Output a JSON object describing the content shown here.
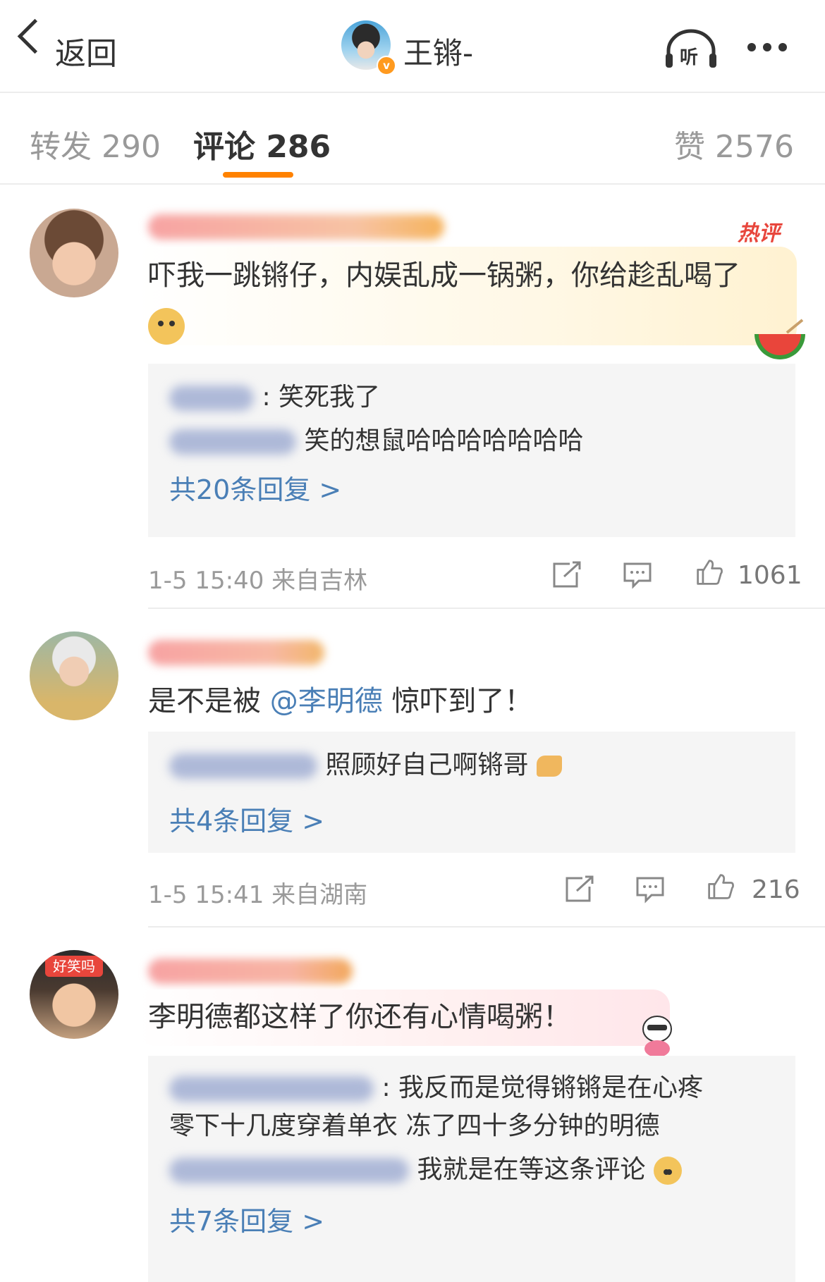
{
  "header": {
    "back_label": "返回",
    "owner_name": "王锵-",
    "listen_label": "听",
    "verified_badge": "v"
  },
  "tabs": {
    "repost": "转发 290",
    "comment": "评论 286",
    "like": "赞 2576"
  },
  "colors": {
    "accent": "#ff8200",
    "link": "#4a7fb6",
    "meta": "#9a9a9a",
    "reply_bg": "#f5f5f5"
  },
  "comments": [
    {
      "badge": "热评",
      "text": "吓我一跳锵仔，内娱乱成一锅粥，你给趁乱喝了",
      "replies": [
        {
          "text": "笑死我了",
          "prefix": ":"
        },
        {
          "text": "笑的想鼠哈哈哈哈哈哈哈",
          "prefix": ""
        }
      ],
      "more": "共20条回复 >",
      "time": "1-5 15:40",
      "location": "来自吉林",
      "likes": "1061"
    },
    {
      "text_before": "是不是被",
      "mention": "@李明德",
      "text_after": "惊吓到了！",
      "replies": [
        {
          "text": "照顾好自己啊锵哥",
          "prefix": ""
        }
      ],
      "more": "共4条回复 >",
      "time": "1-5 15:41",
      "location": "来自湖南",
      "likes": "216"
    },
    {
      "avatar_badge": "好笑吗",
      "text": "李明德都这样了你还有心情喝粥！",
      "replies": [
        {
          "text": "我反而是觉得锵锵是在心疼",
          "prefix": ":"
        },
        {
          "text": "零下十几度穿着单衣 冻了四十多分钟的明德",
          "prefix": ""
        },
        {
          "text": "我就是在等这条评论",
          "prefix": ""
        }
      ],
      "more": "共7条回复 >"
    }
  ]
}
